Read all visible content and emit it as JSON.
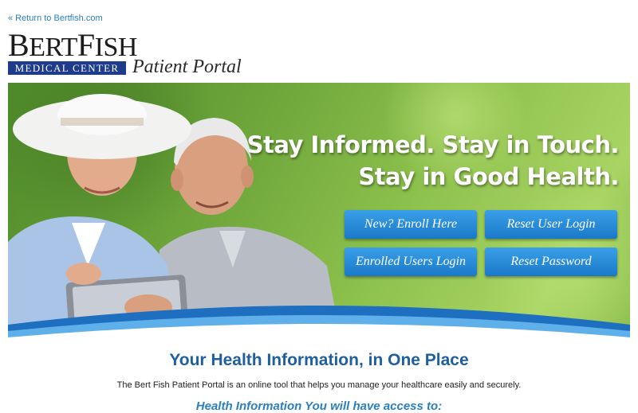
{
  "top_link": {
    "label": "« Return to Bertfish.com"
  },
  "logo": {
    "name_big_1": "B",
    "name_small_1": "ERT",
    "name_big_2": "F",
    "name_small_2": "ISH",
    "bar_text": "MEDICAL CENTER",
    "portal_title": "Patient Portal"
  },
  "hero": {
    "headline_line1": "Stay Informed. Stay in Touch.",
    "headline_line2": "Stay in Good Health.",
    "buttons": {
      "enroll": "New? Enroll Here",
      "reset_login": "Reset User Login",
      "enrolled_login": "Enrolled Users Login",
      "reset_password": "Reset Password"
    }
  },
  "content": {
    "title": "Your Health Information, in One Place",
    "intro": "The Bert Fish Patient Portal is an online tool that helps you manage your healthcare easily and securely.",
    "subhead": "Health Information You will have access to:"
  },
  "colors": {
    "link": "#2a7fc0",
    "logo_bar": "#1f3c8c",
    "button": "#1a78c8",
    "title": "#1f5fa0"
  }
}
